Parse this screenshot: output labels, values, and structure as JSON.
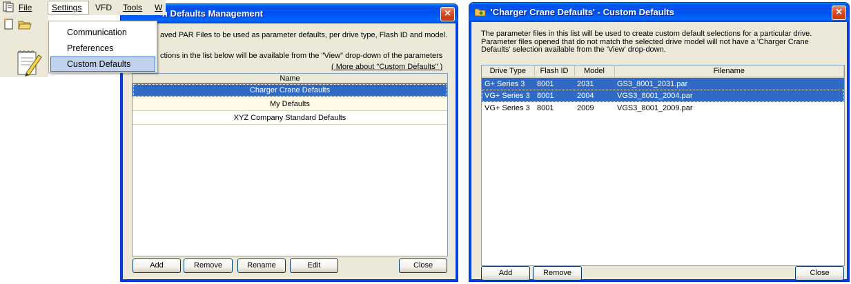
{
  "menu": {
    "file": "File",
    "settings": "Settings",
    "vfd": "VFD",
    "tools": "Tools",
    "window_partial": "W",
    "dropdown": [
      "Communication",
      "Preferences",
      "Custom Defaults"
    ]
  },
  "defaults_window": {
    "title": "n Defaults Management",
    "desc1": "aved PAR Files to be used as parameter defaults, per drive type, Flash ID and model.",
    "desc2": "ctions in the list below will be available from the \"View\" drop-down of the parameters",
    "more_link": "( More about \"Custom Defaults\" )",
    "column": "Name",
    "items": [
      "Charger Crane Defaults",
      "My Defaults",
      "XYZ Company Standard Defaults"
    ],
    "buttons": {
      "add": "Add",
      "remove": "Remove",
      "rename": "Rename",
      "edit": "Edit",
      "close": "Close"
    }
  },
  "custom_window": {
    "title": "'Charger Crane Defaults' - Custom Defaults",
    "desc": "The parameter files in this list will be used to create custom default selections for a particular drive. Parameter files opened that do not match the selected drive model will not have a 'Charger Crane Defaults' selection available from the 'View' drop-down.",
    "columns": [
      "Drive Type",
      "Flash ID",
      "Model",
      "Filename"
    ],
    "rows": [
      [
        "G+ Series 3",
        "8001",
        "2031",
        "GS3_8001_2031.par"
      ],
      [
        "VG+ Series 3",
        "8001",
        "2004",
        "VGS3_8001_2004.par"
      ],
      [
        "VG+ Series 3",
        "8001",
        "2009",
        "VGS3_8001_2009.par"
      ]
    ],
    "buttons": {
      "add": "Add",
      "remove": "Remove",
      "close": "Close"
    }
  },
  "colors": {
    "title_blue": "#0053ee",
    "selection": "#316ac5",
    "xp_face": "#ece9d8",
    "close_red": "#d64a20"
  }
}
